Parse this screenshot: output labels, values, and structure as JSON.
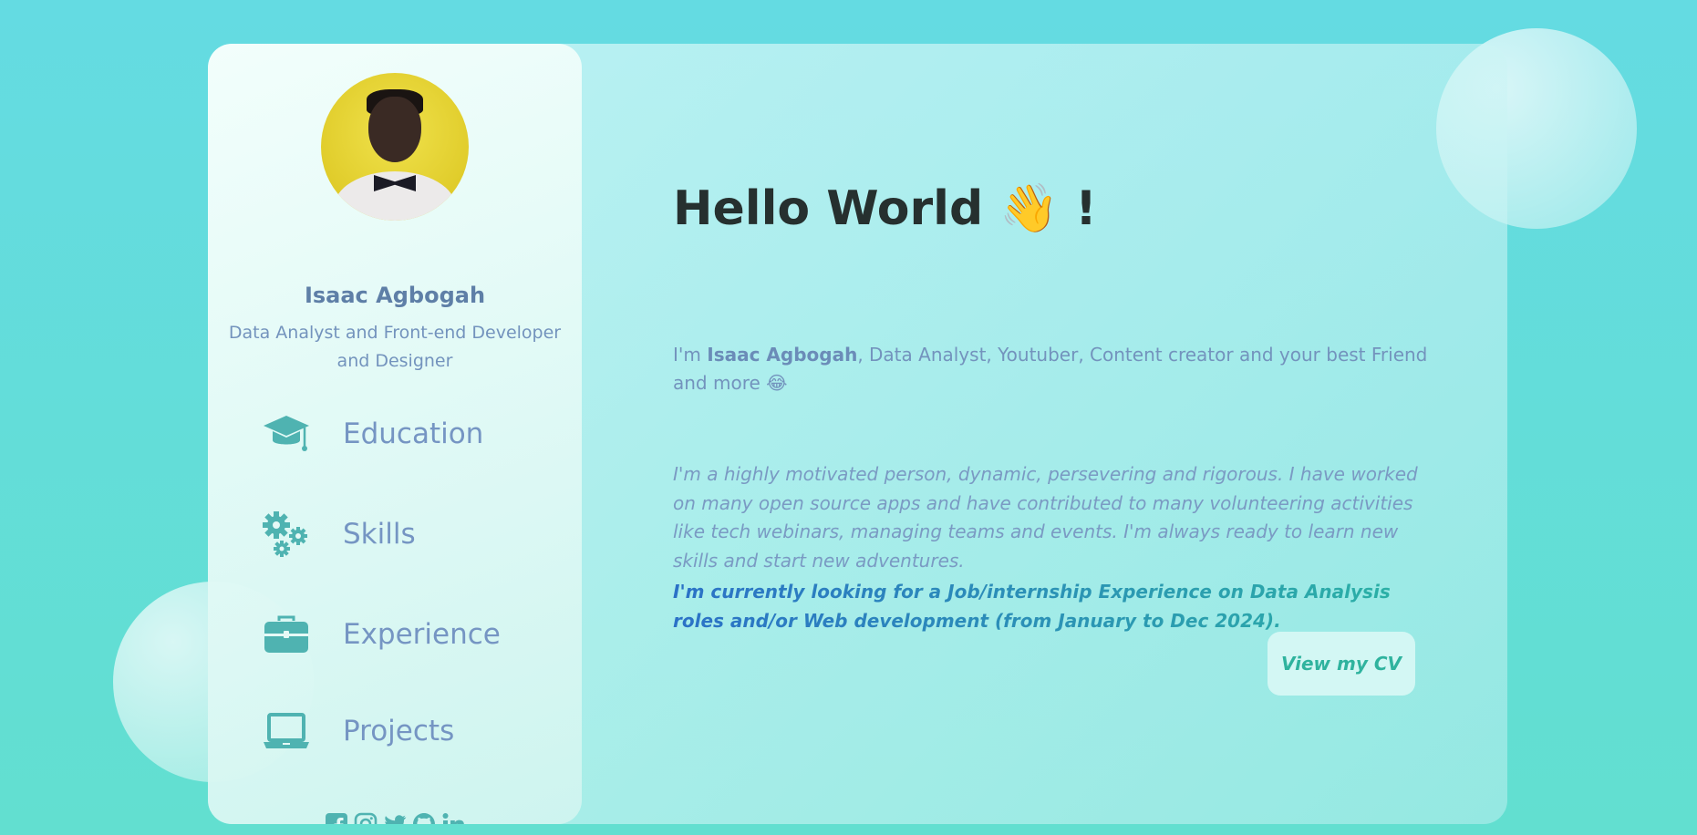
{
  "profile": {
    "name": "Isaac Agbogah",
    "role": "Data Analyst and Front-end Developer and Designer"
  },
  "nav": {
    "items": [
      {
        "label": "Education",
        "icon": "graduation-cap-icon"
      },
      {
        "label": "Skills",
        "icon": "gears-icon"
      },
      {
        "label": "Experience",
        "icon": "briefcase-icon"
      },
      {
        "label": "Projects",
        "icon": "laptop-icon"
      }
    ]
  },
  "socials": [
    "facebook-icon",
    "instagram-icon",
    "twitter-icon",
    "github-icon",
    "linkedin-icon"
  ],
  "main": {
    "hello": "Hello World 👋 !",
    "intro_prefix": "I'm ",
    "intro_name": "Isaac Agbogah",
    "intro_suffix": ", Data Analyst, Youtuber, Content creator and your best Friend and more 😂",
    "bio": "I'm a highly motivated person, dynamic, persevering and rigorous. I have worked on many open source apps and have contributed to many volunteering activities like tech webinars, managing teams and events. I'm always ready to learn new skills and start new adventures.",
    "cta": "I'm currently looking for a Job/internship Experience on Data Analysis roles and/or Web development (from January to Dec 2024).",
    "cv_button": "View my CV"
  },
  "colors": {
    "accent": "#4fb3b1",
    "text_blue": "#7393bd",
    "heading": "#26302f"
  }
}
